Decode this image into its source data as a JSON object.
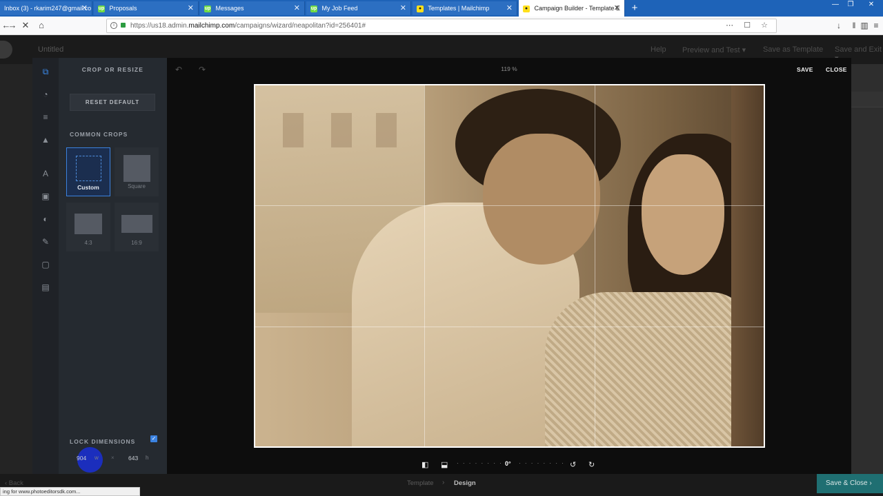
{
  "browser": {
    "tabs": [
      {
        "label": "Inbox (3) - rkarim247@gmail.co",
        "icon": "gmail",
        "active": false
      },
      {
        "label": "Proposals",
        "icon": "upwork",
        "active": false
      },
      {
        "label": "Messages",
        "icon": "upwork",
        "active": false
      },
      {
        "label": "My Job Feed",
        "icon": "upwork",
        "active": false
      },
      {
        "label": "Templates | Mailchimp",
        "icon": "mailchimp",
        "active": false
      },
      {
        "label": "Campaign Builder - Template E",
        "icon": "mailchimp",
        "active": true
      }
    ],
    "favicon_upwork": "up",
    "favicon_mailchimp": "●",
    "close_glyph": "✕",
    "new_tab_glyph": "+",
    "window_controls": [
      "—",
      "❐",
      "✕"
    ],
    "nav": {
      "back": "←",
      "forward": "→",
      "stop": "✕",
      "home": "⌂"
    },
    "url_prefix": "https://us18.admin.",
    "url_domain": "mailchimp.com",
    "url_rest": "/campaigns/wizard/neapolitan?id=256401#",
    "url_icons": "⋯ ☐ ☆",
    "toolbar_icons": [
      "↓",
      "‖",
      "▥",
      "≡"
    ]
  },
  "app": {
    "campaign_title": "Untitled",
    "header_links": [
      "Help",
      "Preview and Test ▾",
      "Save as Template",
      "Save and Exit ▾"
    ]
  },
  "editor": {
    "panel_title": "CROP OR RESIZE",
    "reset_label": "RESET DEFAULT",
    "common_crops_label": "COMMON CROPS",
    "crops": [
      {
        "label": "Custom",
        "selected": true
      },
      {
        "label": "Square",
        "selected": false
      },
      {
        "label": "4:3",
        "selected": false
      },
      {
        "label": "16:9",
        "selected": false
      }
    ],
    "lock_label": "LOCK DIMENSIONS",
    "lock_checked": true,
    "checkbox_glyph": "✓",
    "width_value": "904",
    "width_unit": "w",
    "times": "×",
    "height_value": "643",
    "height_unit": "h",
    "zoom": "119 %",
    "save_label": "SAVE",
    "close_label": "CLOSE",
    "undo_glyph": "↶",
    "redo_glyph": "↷",
    "rotation": "0°",
    "rail_icons": [
      {
        "name": "crop-icon",
        "glyph": "⧉",
        "active": true
      },
      {
        "name": "filter-icon",
        "glyph": "◔",
        "active": false
      },
      {
        "name": "adjust-icon",
        "glyph": "≡",
        "active": false
      },
      {
        "name": "drop-icon",
        "glyph": "▲",
        "active": false
      },
      {
        "name": "text-icon",
        "glyph": "A",
        "active": false
      },
      {
        "name": "sticker-icon",
        "glyph": "▣",
        "active": false
      },
      {
        "name": "shape-icon",
        "glyph": "◐",
        "active": false
      },
      {
        "name": "brush-icon",
        "glyph": "✎",
        "active": false
      },
      {
        "name": "frame-icon",
        "glyph": "▢",
        "active": false
      },
      {
        "name": "layers-icon",
        "glyph": "▤",
        "active": false
      }
    ],
    "tool_icons": {
      "flip_h": "◧",
      "flip_v": "⬓",
      "rotate_ccw": "↺",
      "rotate_cw": "↻"
    },
    "ruler_ticks": "· · · · · · · ·"
  },
  "footer": {
    "back_label": "‹ Back",
    "crumb_template": "Template",
    "crumb_sep": "›",
    "crumb_design": "Design",
    "save_close_label": "Save & Close ›",
    "status_text": "ing for www.photoeditorsdk.com..."
  }
}
